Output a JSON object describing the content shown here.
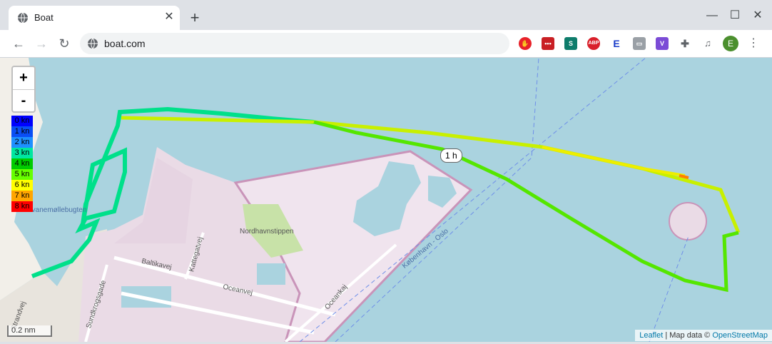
{
  "browser": {
    "tab_title": "Boat",
    "url": "boat.com",
    "profile_initial": "E",
    "accent": "#4b8f2e"
  },
  "icons": {
    "favicon": "globe-icon",
    "close": "close-icon",
    "new_tab": "plus-icon",
    "back": "arrow-left-icon",
    "forward": "arrow-right-icon",
    "reload": "reload-icon",
    "secure": "globe-icon",
    "extensions": "puzzle-icon",
    "media": "media-icon",
    "menu": "dots-menu-icon"
  },
  "map": {
    "zoom_in": "+",
    "zoom_out": "-",
    "legend": [
      {
        "label": "0 kn",
        "color": "#0000ff"
      },
      {
        "label": "1 kn",
        "color": "#0a4ef5"
      },
      {
        "label": "2 kn",
        "color": "#1e90ff"
      },
      {
        "label": "3 kn",
        "color": "#00e6a0"
      },
      {
        "label": "4 kn",
        "color": "#00cc00"
      },
      {
        "label": "5 kn",
        "color": "#66ff00"
      },
      {
        "label": "6 kn",
        "color": "#ffff00"
      },
      {
        "label": "7 kn",
        "color": "#ffa500"
      },
      {
        "label": "8 kn",
        "color": "#ff0000"
      }
    ],
    "time_marker": "1 h",
    "scale": "0.2 nm",
    "attribution_leaflet": "Leaflet",
    "attribution_text": "| Map data ©",
    "attribution_osm": "OpenStreetMap",
    "places": {
      "nordhavnstippen": "Nordhavnstippen",
      "baltikavej": "Baltikavej",
      "kattegatvej": "Kattegatvej",
      "oceanvej": "Oceanvej",
      "oceankaj": "Oceankaj",
      "sundkrogsgade": "Sundkrogsgade",
      "svanemollebugten": "Svanemøllebugten",
      "ferry": "København - Oslo",
      "strandvej": "Strandvej"
    }
  }
}
